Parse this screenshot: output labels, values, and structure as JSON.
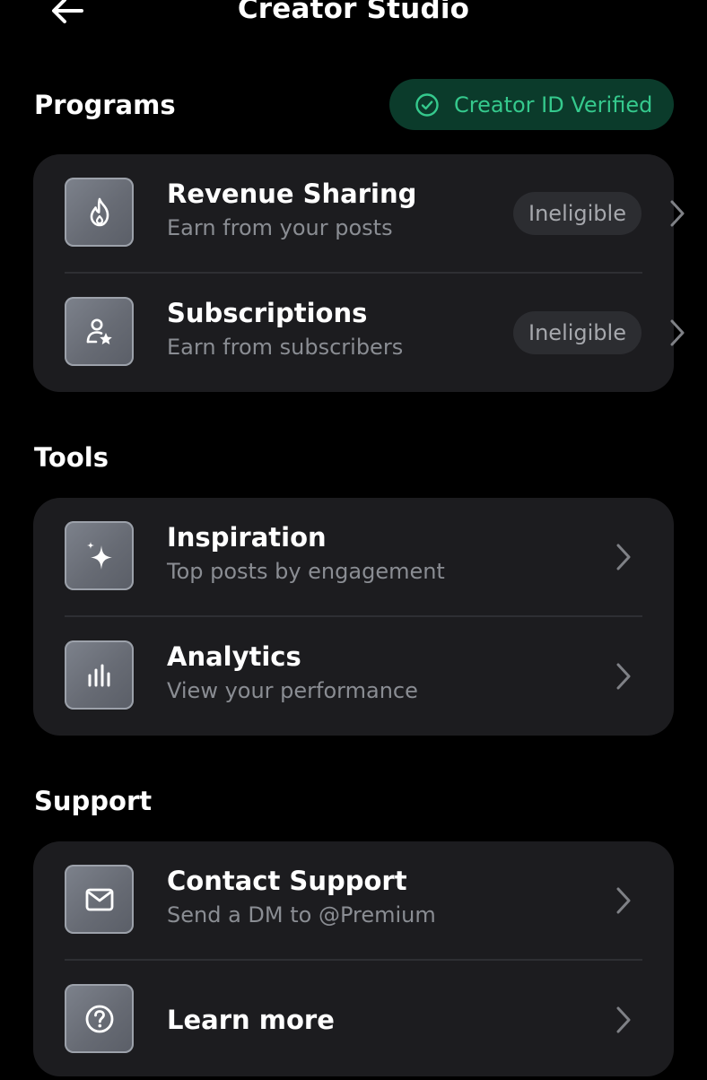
{
  "header": {
    "title": "Creator Studio"
  },
  "programs": {
    "section_title": "Programs",
    "verified_badge": "Creator ID Verified",
    "items": [
      {
        "title": "Revenue Sharing",
        "subtitle": "Earn from your posts",
        "status": "Ineligible",
        "icon": "flame-icon"
      },
      {
        "title": "Subscriptions",
        "subtitle": "Earn from subscribers",
        "status": "Ineligible",
        "icon": "person-star-icon"
      }
    ]
  },
  "tools": {
    "section_title": "Tools",
    "items": [
      {
        "title": "Inspiration",
        "subtitle": "Top posts by engagement",
        "icon": "sparkle-icon"
      },
      {
        "title": "Analytics",
        "subtitle": "View your performance",
        "icon": "bar-chart-icon"
      }
    ]
  },
  "support": {
    "section_title": "Support",
    "items": [
      {
        "title": "Contact Support",
        "subtitle": "Send a DM to @Premium",
        "icon": "envelope-icon"
      },
      {
        "title": "Learn more",
        "icon": "question-icon"
      }
    ]
  },
  "colors": {
    "background": "#000000",
    "card": "#1c1c1f",
    "verified_green": "#35c98d",
    "verified_bg": "#0b3b2b",
    "muted_text": "#8a8d93"
  }
}
